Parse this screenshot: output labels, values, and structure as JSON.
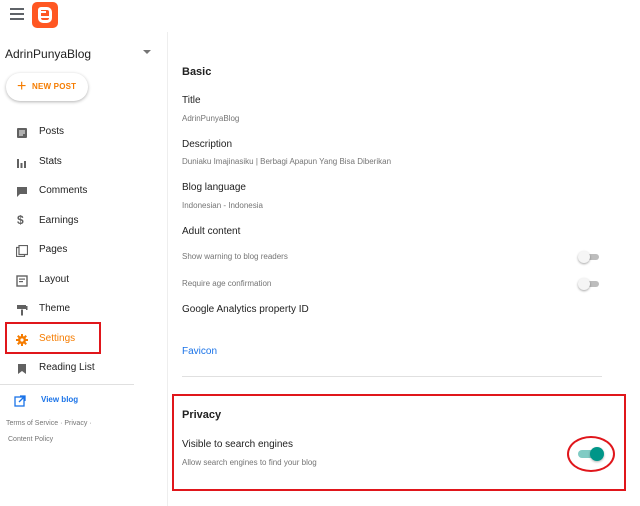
{
  "header": {
    "menu_icon": "hamburger-menu-icon",
    "logo_icon": "blogger-logo-icon",
    "brand_color": "#ff5722"
  },
  "sidebar": {
    "blog_name": "AdrinPunyaBlog",
    "new_post_label": "NEW POST",
    "items": [
      {
        "label": "Posts",
        "icon": "posts-icon"
      },
      {
        "label": "Stats",
        "icon": "stats-icon"
      },
      {
        "label": "Comments",
        "icon": "comments-icon"
      },
      {
        "label": "Earnings",
        "icon": "dollar-icon"
      },
      {
        "label": "Pages",
        "icon": "pages-icon"
      },
      {
        "label": "Layout",
        "icon": "layout-icon"
      },
      {
        "label": "Theme",
        "icon": "paint-roller-icon"
      },
      {
        "label": "Settings",
        "icon": "gear-icon",
        "active": true
      },
      {
        "label": "Reading List",
        "icon": "bookmark-icon"
      }
    ],
    "view_blog_label": "View blog",
    "footer": {
      "terms": "Terms of Service",
      "privacy": "Privacy",
      "content_policy": "Content Policy",
      "separator": "·"
    },
    "accent_color": "#f57c00"
  },
  "main": {
    "basic": {
      "heading": "Basic",
      "title_label": "Title",
      "title_value": "AdrinPunyaBlog",
      "description_label": "Description",
      "description_value": "Duniaku Imajinasiku | Berbagi Apapun Yang Bisa Diberikan",
      "language_label": "Blog language",
      "language_value": "Indonesian - Indonesia",
      "adult_label": "Adult content",
      "warning_label": "Show warning to blog readers",
      "warning_enabled": false,
      "age_label": "Require age confirmation",
      "age_enabled": false,
      "analytics_label": "Google Analytics property ID",
      "favicon_label": "Favicon"
    },
    "privacy": {
      "heading": "Privacy",
      "visible_label": "Visible to search engines",
      "visible_sub": "Allow search engines to find your blog",
      "visible_enabled": true,
      "toggle_on_color": "#009688"
    }
  },
  "annotation_color": "#e0161b"
}
